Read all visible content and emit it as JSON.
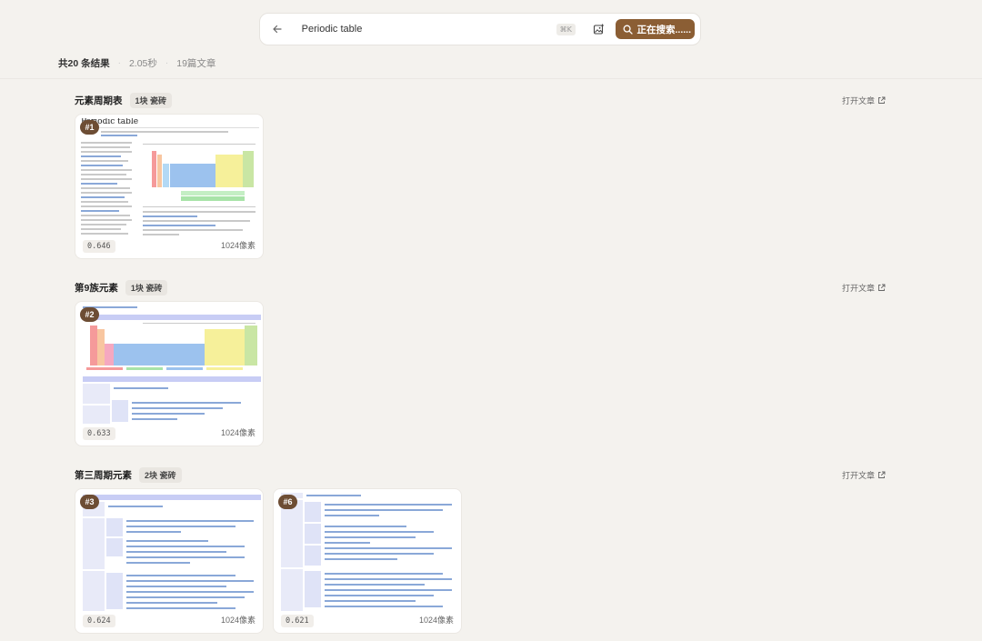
{
  "search": {
    "query": "Periodic table",
    "shortcut": "⌘K",
    "button_label": "正在搜索......"
  },
  "stats": {
    "results": "共20 条结果",
    "time": "2.05秒",
    "articles": "19篇文章"
  },
  "groups": [
    {
      "title": "元素周期表",
      "badge": "1块 瓷砖",
      "open_label": "打开文章",
      "cards": [
        {
          "rank": "#1",
          "score": "0.646",
          "size": "1024像素",
          "heading": "Periodic table"
        }
      ]
    },
    {
      "title": "第9族元素",
      "badge": "1块 瓷砖",
      "open_label": "打开文章",
      "cards": [
        {
          "rank": "#2",
          "score": "0.633",
          "size": "1024像素"
        }
      ]
    },
    {
      "title": "第三周期元素",
      "badge": "2块 瓷砖",
      "open_label": "打开文章",
      "cards": [
        {
          "rank": "#3",
          "score": "0.624",
          "size": "1024像素"
        },
        {
          "rank": "#6",
          "score": "0.621",
          "size": "1024像素"
        }
      ]
    }
  ],
  "colors": {
    "accent": "#8b5e34",
    "rank_badge": "#6d4d34",
    "background": "#f4f2ee"
  },
  "icons": {
    "back": "arrow-left-icon",
    "image_search": "image-search-icon",
    "search": "search-icon",
    "external": "external-link-icon"
  }
}
